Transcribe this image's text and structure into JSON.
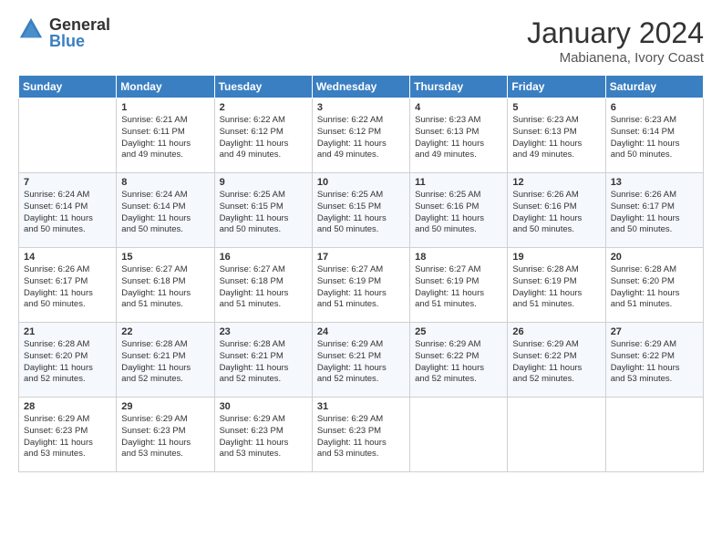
{
  "logo": {
    "general": "General",
    "blue": "Blue"
  },
  "header": {
    "title": "January 2024",
    "subtitle": "Mabianena, Ivory Coast"
  },
  "days_of_week": [
    "Sunday",
    "Monday",
    "Tuesday",
    "Wednesday",
    "Thursday",
    "Friday",
    "Saturday"
  ],
  "weeks": [
    [
      {
        "num": "",
        "info": ""
      },
      {
        "num": "1",
        "info": "Sunrise: 6:21 AM\nSunset: 6:11 PM\nDaylight: 11 hours\nand 49 minutes."
      },
      {
        "num": "2",
        "info": "Sunrise: 6:22 AM\nSunset: 6:12 PM\nDaylight: 11 hours\nand 49 minutes."
      },
      {
        "num": "3",
        "info": "Sunrise: 6:22 AM\nSunset: 6:12 PM\nDaylight: 11 hours\nand 49 minutes."
      },
      {
        "num": "4",
        "info": "Sunrise: 6:23 AM\nSunset: 6:13 PM\nDaylight: 11 hours\nand 49 minutes."
      },
      {
        "num": "5",
        "info": "Sunrise: 6:23 AM\nSunset: 6:13 PM\nDaylight: 11 hours\nand 49 minutes."
      },
      {
        "num": "6",
        "info": "Sunrise: 6:23 AM\nSunset: 6:14 PM\nDaylight: 11 hours\nand 50 minutes."
      }
    ],
    [
      {
        "num": "7",
        "info": "Sunrise: 6:24 AM\nSunset: 6:14 PM\nDaylight: 11 hours\nand 50 minutes."
      },
      {
        "num": "8",
        "info": "Sunrise: 6:24 AM\nSunset: 6:14 PM\nDaylight: 11 hours\nand 50 minutes."
      },
      {
        "num": "9",
        "info": "Sunrise: 6:25 AM\nSunset: 6:15 PM\nDaylight: 11 hours\nand 50 minutes."
      },
      {
        "num": "10",
        "info": "Sunrise: 6:25 AM\nSunset: 6:15 PM\nDaylight: 11 hours\nand 50 minutes."
      },
      {
        "num": "11",
        "info": "Sunrise: 6:25 AM\nSunset: 6:16 PM\nDaylight: 11 hours\nand 50 minutes."
      },
      {
        "num": "12",
        "info": "Sunrise: 6:26 AM\nSunset: 6:16 PM\nDaylight: 11 hours\nand 50 minutes."
      },
      {
        "num": "13",
        "info": "Sunrise: 6:26 AM\nSunset: 6:17 PM\nDaylight: 11 hours\nand 50 minutes."
      }
    ],
    [
      {
        "num": "14",
        "info": "Sunrise: 6:26 AM\nSunset: 6:17 PM\nDaylight: 11 hours\nand 50 minutes."
      },
      {
        "num": "15",
        "info": "Sunrise: 6:27 AM\nSunset: 6:18 PM\nDaylight: 11 hours\nand 51 minutes."
      },
      {
        "num": "16",
        "info": "Sunrise: 6:27 AM\nSunset: 6:18 PM\nDaylight: 11 hours\nand 51 minutes."
      },
      {
        "num": "17",
        "info": "Sunrise: 6:27 AM\nSunset: 6:19 PM\nDaylight: 11 hours\nand 51 minutes."
      },
      {
        "num": "18",
        "info": "Sunrise: 6:27 AM\nSunset: 6:19 PM\nDaylight: 11 hours\nand 51 minutes."
      },
      {
        "num": "19",
        "info": "Sunrise: 6:28 AM\nSunset: 6:19 PM\nDaylight: 11 hours\nand 51 minutes."
      },
      {
        "num": "20",
        "info": "Sunrise: 6:28 AM\nSunset: 6:20 PM\nDaylight: 11 hours\nand 51 minutes."
      }
    ],
    [
      {
        "num": "21",
        "info": "Sunrise: 6:28 AM\nSunset: 6:20 PM\nDaylight: 11 hours\nand 52 minutes."
      },
      {
        "num": "22",
        "info": "Sunrise: 6:28 AM\nSunset: 6:21 PM\nDaylight: 11 hours\nand 52 minutes."
      },
      {
        "num": "23",
        "info": "Sunrise: 6:28 AM\nSunset: 6:21 PM\nDaylight: 11 hours\nand 52 minutes."
      },
      {
        "num": "24",
        "info": "Sunrise: 6:29 AM\nSunset: 6:21 PM\nDaylight: 11 hours\nand 52 minutes."
      },
      {
        "num": "25",
        "info": "Sunrise: 6:29 AM\nSunset: 6:22 PM\nDaylight: 11 hours\nand 52 minutes."
      },
      {
        "num": "26",
        "info": "Sunrise: 6:29 AM\nSunset: 6:22 PM\nDaylight: 11 hours\nand 52 minutes."
      },
      {
        "num": "27",
        "info": "Sunrise: 6:29 AM\nSunset: 6:22 PM\nDaylight: 11 hours\nand 53 minutes."
      }
    ],
    [
      {
        "num": "28",
        "info": "Sunrise: 6:29 AM\nSunset: 6:23 PM\nDaylight: 11 hours\nand 53 minutes."
      },
      {
        "num": "29",
        "info": "Sunrise: 6:29 AM\nSunset: 6:23 PM\nDaylight: 11 hours\nand 53 minutes."
      },
      {
        "num": "30",
        "info": "Sunrise: 6:29 AM\nSunset: 6:23 PM\nDaylight: 11 hours\nand 53 minutes."
      },
      {
        "num": "31",
        "info": "Sunrise: 6:29 AM\nSunset: 6:23 PM\nDaylight: 11 hours\nand 53 minutes."
      },
      {
        "num": "",
        "info": ""
      },
      {
        "num": "",
        "info": ""
      },
      {
        "num": "",
        "info": ""
      }
    ]
  ]
}
